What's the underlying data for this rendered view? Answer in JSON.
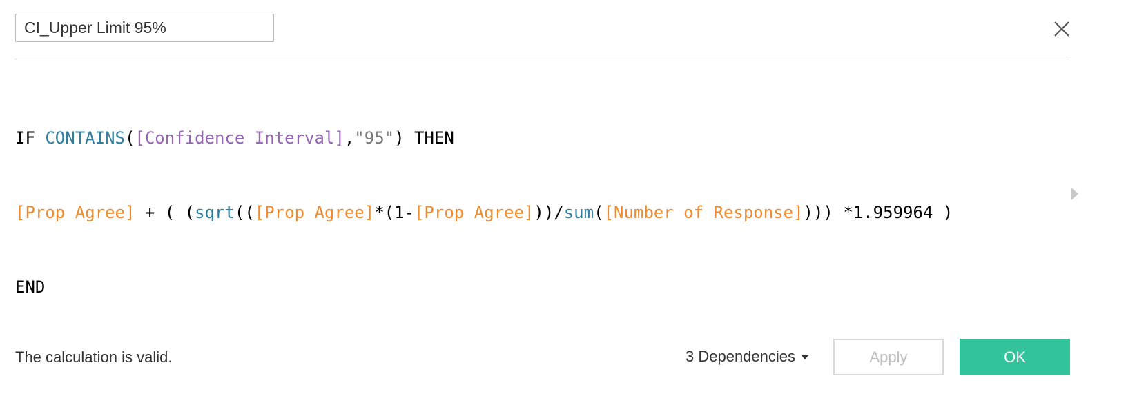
{
  "calc_name": "CI_Upper Limit 95%",
  "icons": {
    "close": "close-icon",
    "expand": "triangle-right-icon",
    "dependencies_caret": "caret-down-icon"
  },
  "formula": {
    "line1": [
      {
        "t": "IF",
        "c": "kw"
      },
      {
        "t": " ",
        "c": "op"
      },
      {
        "t": "CONTAINS",
        "c": "fn"
      },
      {
        "t": "(",
        "c": "op"
      },
      {
        "t": "[Confidence Interval]",
        "c": "dim"
      },
      {
        "t": ",",
        "c": "op"
      },
      {
        "t": "\"95\"",
        "c": "str"
      },
      {
        "t": ") ",
        "c": "op"
      },
      {
        "t": "THEN",
        "c": "kw"
      }
    ],
    "line2": [
      {
        "t": "[Prop Agree]",
        "c": "fld"
      },
      {
        "t": " + ( (",
        "c": "op"
      },
      {
        "t": "sqrt",
        "c": "fn"
      },
      {
        "t": "((",
        "c": "op"
      },
      {
        "t": "[Prop Agree]",
        "c": "fld"
      },
      {
        "t": "*(1-",
        "c": "op"
      },
      {
        "t": "[Prop Agree]",
        "c": "fld"
      },
      {
        "t": "))/",
        "c": "op"
      },
      {
        "t": "sum",
        "c": "fn"
      },
      {
        "t": "(",
        "c": "op"
      },
      {
        "t": "[Number of Response]",
        "c": "fld"
      },
      {
        "t": "))) *1.959964 )",
        "c": "op"
      }
    ],
    "line3": [
      {
        "t": "END",
        "c": "kw"
      }
    ]
  },
  "footer": {
    "status": "The calculation is valid.",
    "dependencies_label": "3 Dependencies",
    "apply_label": "Apply",
    "ok_label": "OK"
  },
  "colors": {
    "keyword": "#000000",
    "function": "#2f7fa0",
    "dimension": "#9466b3",
    "measure_field": "#f08a2c",
    "string": "#7a7a7a",
    "ok_button": "#33c39a"
  }
}
